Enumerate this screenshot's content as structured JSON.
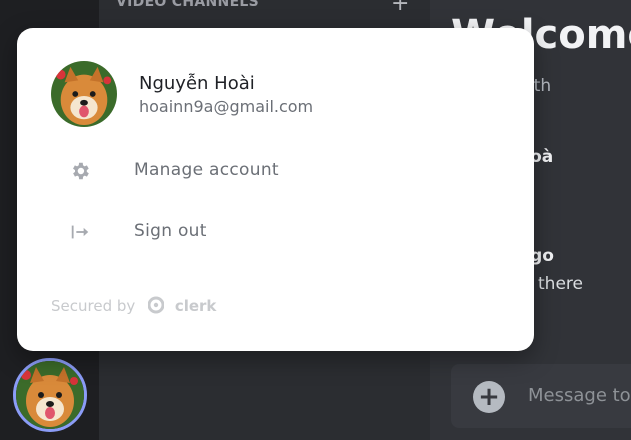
{
  "sidebar": {
    "section_header": "VIDEO CHANNELS",
    "add_icon": "plus-icon"
  },
  "chat": {
    "welcome_title": "Welcome",
    "welcome_sub": "e start of th",
    "messages": [
      {
        "author": "guyễn Hoà",
        "text": ""
      },
      {
        "author": "guyen Ngo",
        "text": "there"
      }
    ],
    "composer_placeholder": "Message to"
  },
  "popover": {
    "user_name": "Nguyễn Hoài",
    "user_email": "hoainn9a@gmail.com",
    "menu": [
      {
        "label": "Manage account",
        "icon": "gear-icon"
      },
      {
        "label": "Sign out",
        "icon": "sign-out-icon"
      }
    ],
    "footer_text": "Secured by",
    "footer_brand": "clerk"
  },
  "colors": {
    "accent": "#8b9cf7",
    "rail_bg": "#1e1f22",
    "sidebar_bg": "#2b2d31",
    "chat_bg": "#313338",
    "card_bg": "#ffffff"
  }
}
